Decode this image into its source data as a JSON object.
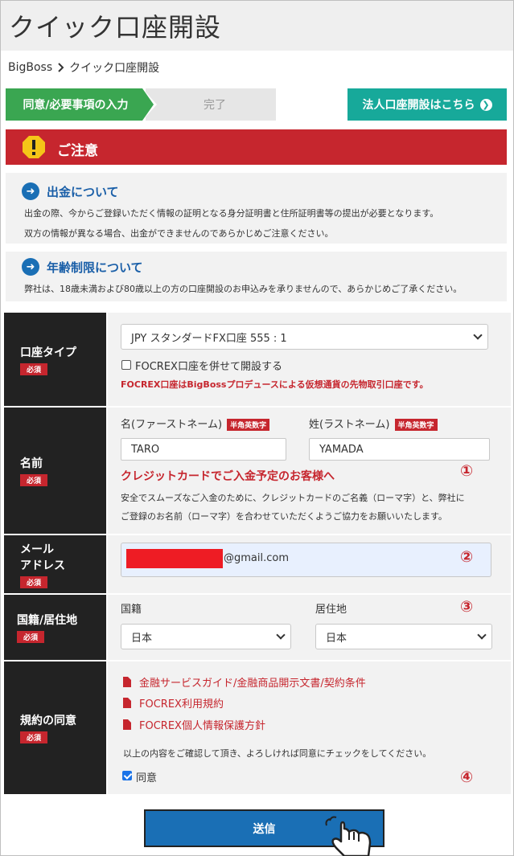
{
  "page": {
    "title": "クイック口座開設"
  },
  "breadcrumb": {
    "home": "BigBoss",
    "current": "クイック口座開設"
  },
  "steps": {
    "step1": "同意/必要事項の入力",
    "step2": "完了"
  },
  "corporate_button": {
    "label": "法人口座開設はこちら"
  },
  "notice": {
    "title": "ご注意"
  },
  "withdrawal": {
    "title": "出金について",
    "line1": "出金の際、今からご登録いただく情報の証明となる身分証明書と住所証明書等の提出が必要となります。",
    "line2": "双方の情報が異なる場合、出金ができませんのであらかじめご注意ください。"
  },
  "age": {
    "title": "年齢制限について",
    "line1": "弊社は、18歳未満および80歳以上の方の口座開設のお申込みを承りませんので、あらかじめご了承ください。"
  },
  "required_label": "必須",
  "account_type": {
    "label": "口座タイプ",
    "selected": "JPY スタンダードFX口座 555 : 1",
    "focrex_checkbox": "FOCREX口座を併せて開設する",
    "focrex_note": "FOCREX口座はBigBossプロデュースによる仮想通貨の先物取引口座です。"
  },
  "name": {
    "label": "名前",
    "first_label": "名(ファーストネーム)",
    "last_label": "姓(ラストネーム)",
    "tag": "半角英数字",
    "first_value": "TARO",
    "last_value": "YAMADA",
    "card_heading": "クレジットカードでご入金予定のお客様へ",
    "note_line1": "安全でスムーズなご入金のために、クレジットカードのご名義（ローマ字）と、弊社に",
    "note_line2": "ご登録のお名前（ローマ字）を合わせていただくようご協力をお願いいたします。",
    "marker": "①"
  },
  "email": {
    "label_line1": "メール",
    "label_line2": "アドレス",
    "value_suffix": "@gmail.com",
    "redaction_color": "#ee1c24",
    "marker": "②"
  },
  "country": {
    "label": "国籍/居住地",
    "nationality_label": "国籍",
    "residence_label": "居住地",
    "nationality_value": "日本",
    "residence_value": "日本",
    "marker": "③"
  },
  "terms": {
    "label": "規約の同意",
    "links": [
      "金融サービスガイド/金融商品開示文書/契約条件",
      "FOCREX利用規約",
      "FOCREX個人情報保護方針"
    ],
    "instruction": "以上の内容をご確認して頂き、よろしければ同意にチェックをしてください。",
    "agree_label": "同意",
    "agree_checked": true,
    "marker": "④"
  },
  "submit": {
    "label": "送信"
  },
  "colors": {
    "accent_green": "#3aa651",
    "accent_teal": "#17a99a",
    "alert_red": "#c6262e",
    "primary_blue": "#1a6fb5"
  }
}
